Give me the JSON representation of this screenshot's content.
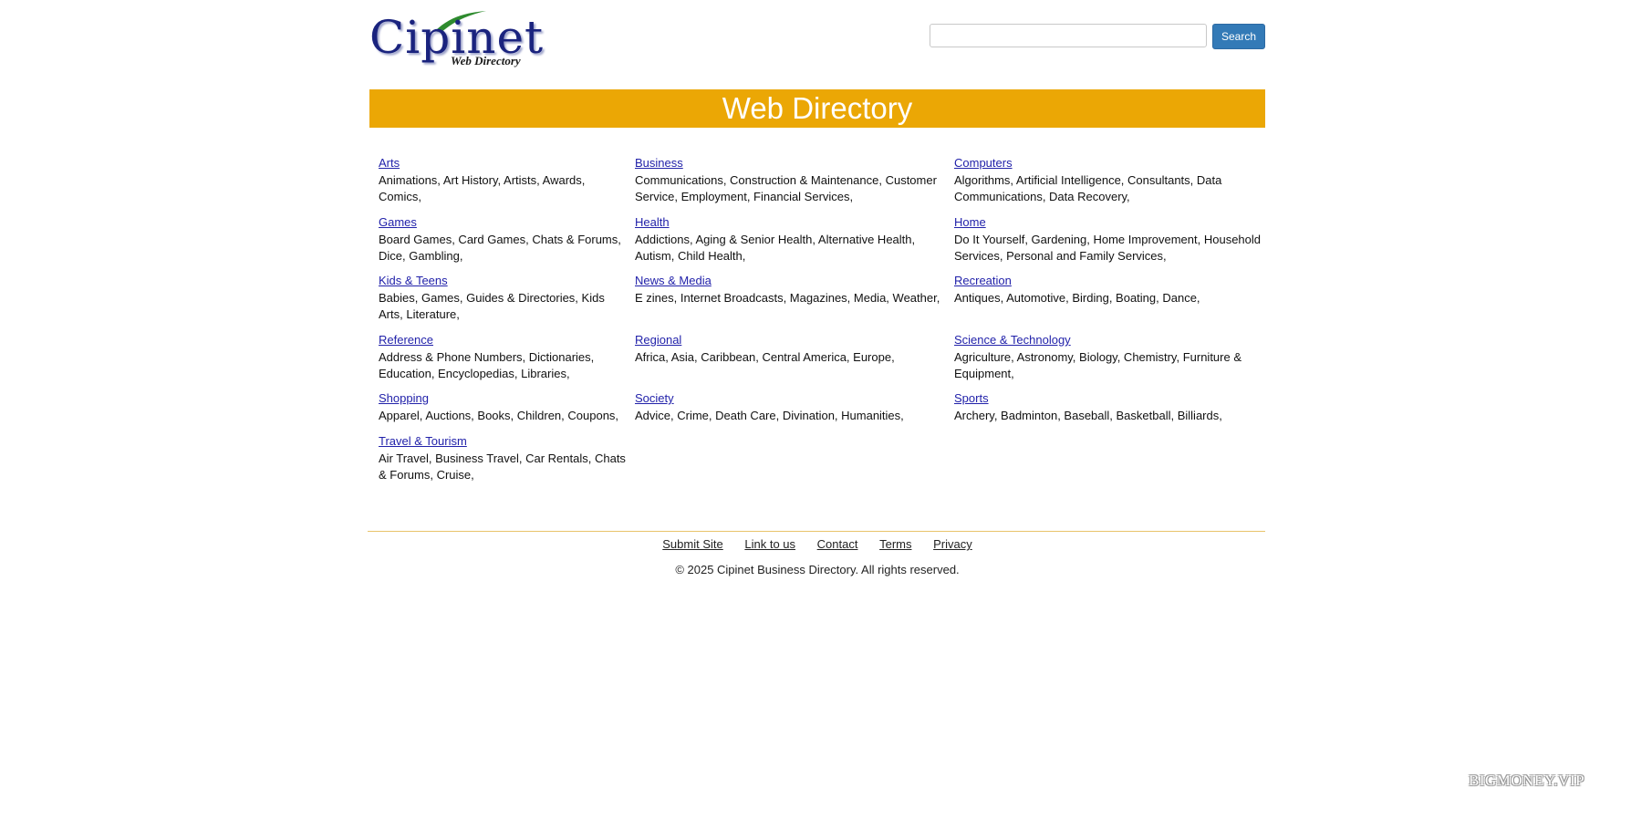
{
  "header": {
    "logo_text": "Cipinet",
    "logo_tagline": "Web Directory",
    "search_placeholder": "",
    "search_button": "Search"
  },
  "banner": {
    "title": "Web Directory"
  },
  "categories": [
    {
      "name": "Arts",
      "subs": "Animations, Art History, Artists, Awards, Comics,"
    },
    {
      "name": "Business",
      "subs": "Communications, Construction & Maintenance, Customer Service, Employment, Financial Services,"
    },
    {
      "name": "Computers",
      "subs": "Algorithms, Artificial Intelligence, Consultants, Data Communications, Data Recovery,"
    },
    {
      "name": "Games",
      "subs": "Board Games, Card Games, Chats & Forums, Dice, Gambling,"
    },
    {
      "name": "Health",
      "subs": "Addictions, Aging & Senior Health, Alternative Health, Autism, Child Health,"
    },
    {
      "name": "Home",
      "subs": "Do It Yourself, Gardening, Home Improvement, Household Services, Personal and Family Services,"
    },
    {
      "name": "Kids & Teens",
      "subs": "Babies, Games, Guides & Directories, Kids Arts, Literature,"
    },
    {
      "name": "News & Media",
      "subs": "E zines, Internet Broadcasts, Magazines, Media, Weather,"
    },
    {
      "name": "Recreation",
      "subs": "Antiques, Automotive, Birding, Boating, Dance,"
    },
    {
      "name": "Reference",
      "subs": "Address & Phone Numbers, Dictionaries, Education, Encyclopedias, Libraries,"
    },
    {
      "name": "Regional",
      "subs": "Africa, Asia, Caribbean, Central America, Europe,"
    },
    {
      "name": "Science & Technology",
      "subs": "Agriculture, Astronomy, Biology, Chemistry, Furniture & Equipment,"
    },
    {
      "name": "Shopping",
      "subs": "Apparel, Auctions, Books, Children, Coupons,"
    },
    {
      "name": "Society",
      "subs": "Advice, Crime, Death Care, Divination, Humanities,"
    },
    {
      "name": "Sports",
      "subs": "Archery, Badminton, Baseball, Basketball, Billiards,"
    },
    {
      "name": "Travel & Tourism",
      "subs": "Air Travel, Business Travel, Car Rentals, Chats & Forums, Cruise,"
    }
  ],
  "footer": {
    "links": [
      "Submit Site",
      "Link to us",
      "Contact",
      "Terms",
      "Privacy"
    ],
    "copyright": "© 2025 Cipinet Business Directory. All rights reserved."
  },
  "watermark": "BIGMONEY.VIP",
  "colors": {
    "banner": "#eba705",
    "search_button": "#337ab7",
    "link": "#2222aa",
    "logo": "#1a237e"
  }
}
